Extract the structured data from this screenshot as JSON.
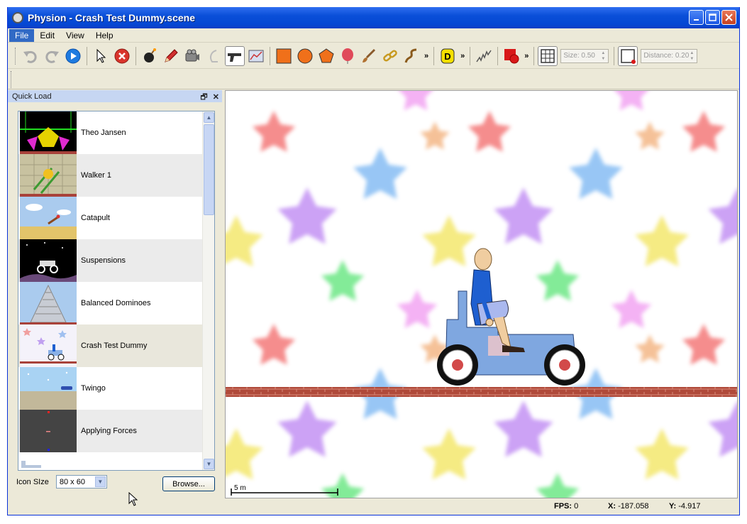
{
  "window": {
    "title": "Physion - Crash Test Dummy.scene"
  },
  "menu": [
    {
      "label": "File"
    },
    {
      "label": "Edit"
    },
    {
      "label": "View"
    },
    {
      "label": "Help"
    }
  ],
  "toolbar": {
    "size_label": "Size: 0.50",
    "distance_label": "Distance: 0.20",
    "overflow": "»"
  },
  "quick_load": {
    "title": "Quick Load",
    "items": [
      {
        "label": "Theo Jansen"
      },
      {
        "label": "Walker 1"
      },
      {
        "label": "Catapult"
      },
      {
        "label": "Suspensions"
      },
      {
        "label": "Balanced Dominoes"
      },
      {
        "label": "Crash Test Dummy"
      },
      {
        "label": "Twingo"
      },
      {
        "label": "Applying Forces"
      }
    ],
    "icon_size_label": "Icon SIze",
    "icon_size_value": "80 x 60",
    "browse_label": "Browse..."
  },
  "canvas": {
    "scale_label": "5 m"
  },
  "status": {
    "fps_label": "FPS:",
    "fps_value": "0",
    "x_label": "X:",
    "x_value": "-187.058",
    "y_label": "Y:",
    "y_value": "-4.917"
  },
  "colors": {
    "title_bar": "#0548d4",
    "panel_header": "#c6d6f2",
    "brick": "#b04a3a",
    "vehicle": "#7fa7e0",
    "dummy_shirt": "#1e5fd0"
  }
}
